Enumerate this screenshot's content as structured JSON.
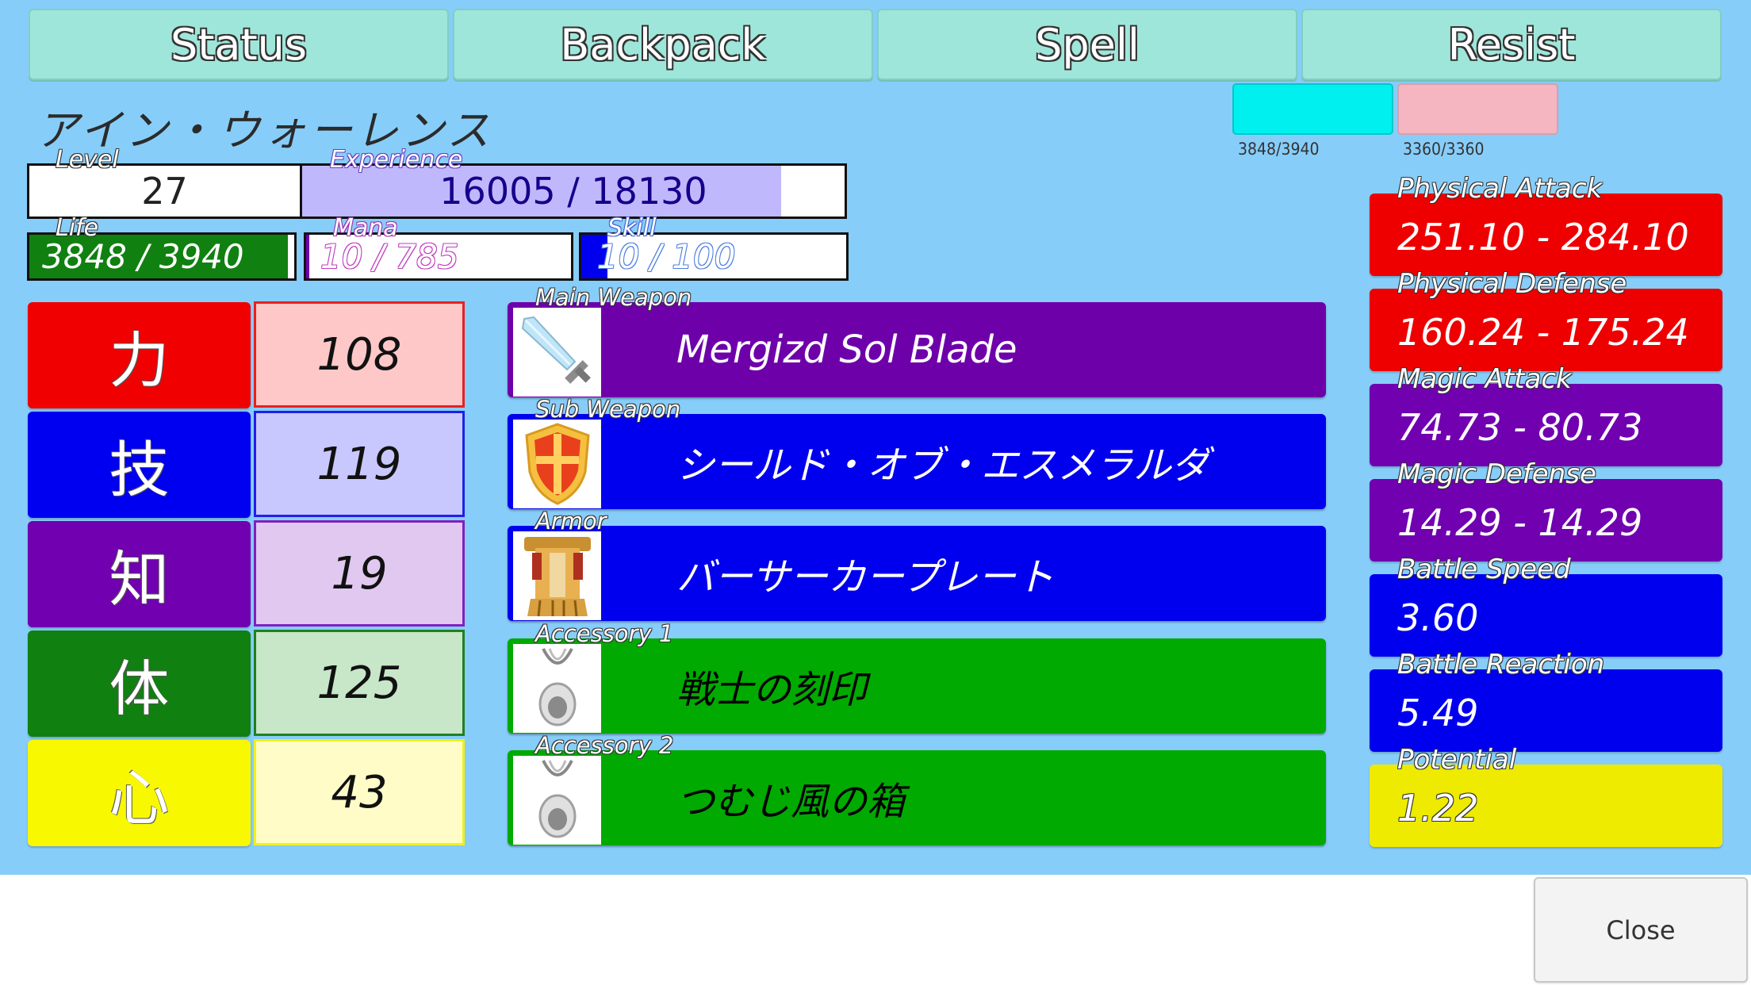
{
  "tabs": [
    {
      "label": "Status"
    },
    {
      "label": "Backpack"
    },
    {
      "label": "Spell"
    },
    {
      "label": "Resist"
    }
  ],
  "resist": {
    "life_gauge": {
      "text": "3848/3940",
      "color": "#00f0ef"
    },
    "other_gauge": {
      "text": "3360/3360",
      "color": "#f5b5c1"
    }
  },
  "character": {
    "name": "アイン・ウォーレンス",
    "level_label": "Level",
    "level": "27",
    "experience_label": "Experience",
    "experience_text": "16005 / 18130",
    "experience_fraction": 0.883,
    "life_label": "Life",
    "life_text": "3848 / 3940",
    "life_fraction": 0.977,
    "mana_label": "Mana",
    "mana_text": "10 / 785",
    "mana_fraction": 0.013,
    "skill_label": "Skill",
    "skill_text": "10 / 100",
    "skill_fraction": 0.1
  },
  "attributes": [
    {
      "name": "力",
      "value": "108",
      "color": "#f00000",
      "value_bg": "#ffc8c8",
      "border": "#e82020"
    },
    {
      "name": "技",
      "value": "119",
      "color": "#0000f0",
      "value_bg": "#c8c8ff",
      "border": "#2020e8"
    },
    {
      "name": "知",
      "value": "19",
      "color": "#7000b0",
      "value_bg": "#e0c8f0",
      "border": "#8020c0"
    },
    {
      "name": "体",
      "value": "125",
      "color": "#108010",
      "value_bg": "#c8e6c8",
      "border": "#208020"
    },
    {
      "name": "心",
      "value": "43",
      "color": "#f8f800",
      "value_bg": "#fffcc8",
      "border": "#f0f020"
    }
  ],
  "equipment": [
    {
      "slot": "Main Weapon",
      "name": "Mergizd Sol Blade",
      "icon": "sword-icon",
      "color": "#6e00aa",
      "text_color": "#ffffff"
    },
    {
      "slot": "Sub Weapon",
      "name": "シールド・オブ・エスメラルダ",
      "icon": "shield-icon",
      "color": "#0000ee",
      "text_color": "#ffffff"
    },
    {
      "slot": "Armor",
      "name": "バーサーカープレート",
      "icon": "armor-icon",
      "color": "#0000ee",
      "text_color": "#ffffff"
    },
    {
      "slot": "Accessory 1",
      "name": "戦士の刻印",
      "icon": "pendant-icon",
      "color": "#00aa00",
      "text_color": "#000000"
    },
    {
      "slot": "Accessory 2",
      "name": "つむじ風の箱",
      "icon": "pendant-icon",
      "color": "#00aa00",
      "text_color": "#000000"
    }
  ],
  "stats": [
    {
      "label": "Physical Attack",
      "value": "251.10 - 284.10",
      "color": "#ee0000"
    },
    {
      "label": "Physical Defense",
      "value": "160.24 - 175.24",
      "color": "#ee0000"
    },
    {
      "label": "Magic Attack",
      "value": "74.73 - 80.73",
      "color": "#7000b0"
    },
    {
      "label": "Magic Defense",
      "value": "14.29 - 14.29",
      "color": "#7000b0"
    },
    {
      "label": "Battle Speed",
      "value": "3.60",
      "color": "#0000ee"
    },
    {
      "label": "Battle Reaction",
      "value": "5.49",
      "color": "#0000ee"
    },
    {
      "label": "Potential",
      "value": "1.22",
      "color": "#eeea00"
    }
  ],
  "close_label": "Close"
}
